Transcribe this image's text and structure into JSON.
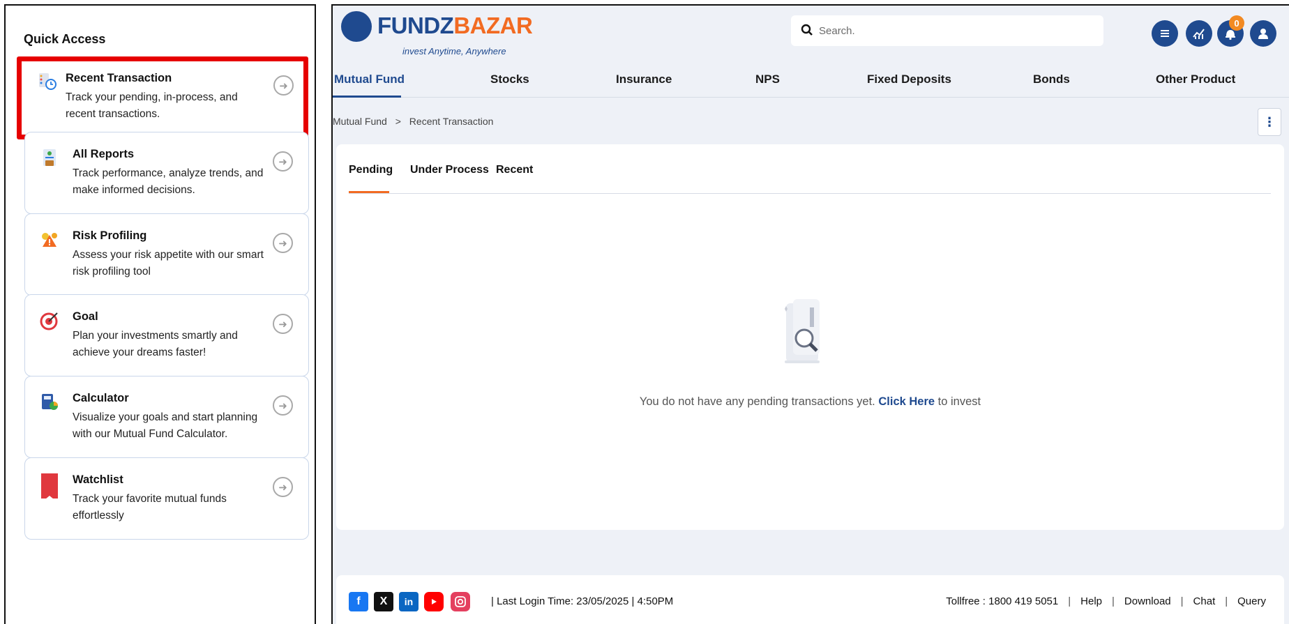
{
  "quick_access": {
    "title": "Quick Access",
    "items": [
      {
        "name": "Recent Transaction",
        "desc": "Track your pending, in-process, and recent transactions.",
        "icon": "transaction-clock-icon"
      },
      {
        "name": "All Reports",
        "desc": "Track performance, analyze trends, and make informed decisions.",
        "icon": "reports-icon"
      },
      {
        "name": "Risk Profiling",
        "desc": "Assess your risk appetite with our smart risk profiling tool",
        "icon": "risk-warning-icon"
      },
      {
        "name": "Goal",
        "desc": "Plan your investments smartly and achieve your dreams faster!",
        "icon": "target-icon"
      },
      {
        "name": "Calculator",
        "desc": "Visualize your goals and start planning with our Mutual Fund Calculator.",
        "icon": "calculator-icon"
      },
      {
        "name": "Watchlist",
        "desc": "Track your favorite mutual funds effortlessly",
        "icon": "bookmark-icon"
      }
    ]
  },
  "header": {
    "logo_left": "FUNDZ",
    "logo_right": "BAZAR",
    "logo_tag": "invest Anytime, Anywhere",
    "search_placeholder": "Search.",
    "notification_count": "0"
  },
  "nav": [
    "Mutual Fund",
    "Stocks",
    "Insurance",
    "NPS",
    "Fixed Deposits",
    "Bonds",
    "Other Product"
  ],
  "breadcrumb": {
    "parent": "Mutual Fund",
    "sep": ">",
    "current": "Recent Transaction"
  },
  "tabs": [
    "Pending",
    "Under Process",
    "Recent"
  ],
  "empty": {
    "before": "You do not have any pending transactions yet. ",
    "link": "Click Here",
    "after": " to invest"
  },
  "footer": {
    "last_login": "| Last Login Time: 23/05/2025 | 4:50PM",
    "tollfree": "Tollfree : 1800 419 5051",
    "links": [
      "Help",
      "Download",
      "Chat",
      "Query"
    ]
  },
  "colors": {
    "brand_blue": "#1f4a8f",
    "brand_orange": "#f26b22",
    "highlight_red": "#e60000"
  }
}
